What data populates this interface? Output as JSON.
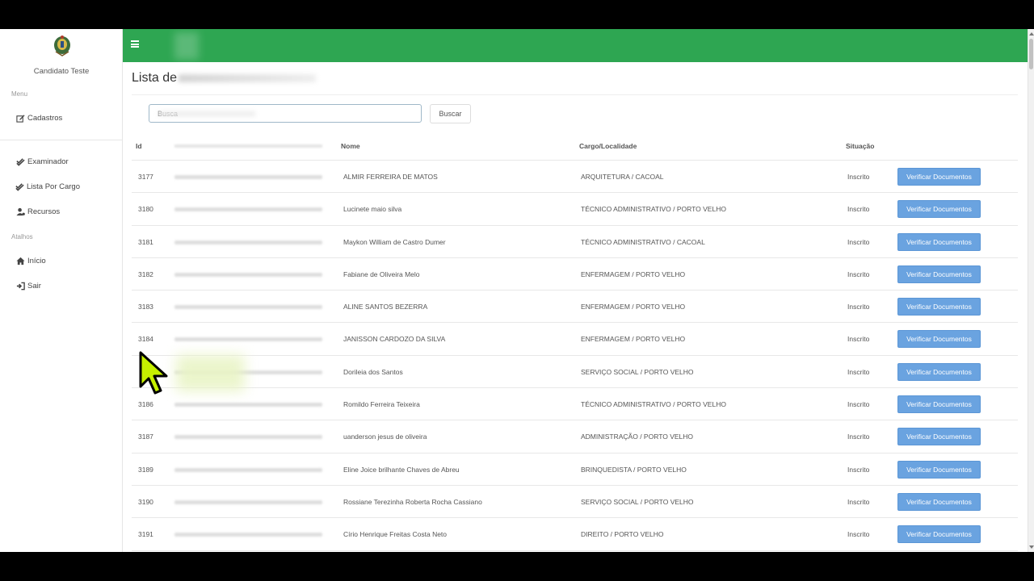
{
  "sidebar": {
    "user_name": "Candidato Teste",
    "menu_title": "Menu",
    "menu_items": [
      {
        "label": "Cadastros",
        "icon": "edit-icon"
      }
    ],
    "exam_items": [
      {
        "label": "Examinador",
        "icon": "check-double-icon"
      },
      {
        "label": "Lista Por Cargo",
        "icon": "check-double-icon"
      },
      {
        "label": "Recursos",
        "icon": "user-gear-icon"
      }
    ],
    "shortcuts_title": "Atalhos",
    "shortcut_items": [
      {
        "label": "Início",
        "icon": "home-icon"
      },
      {
        "label": "Sair",
        "icon": "sign-out-icon"
      }
    ]
  },
  "topbar": {
    "color": "#2ea652",
    "menu_icon": "hamburger-icon"
  },
  "main": {
    "title": "Lista de",
    "search": {
      "placeholder": "Busca",
      "button_label": "Buscar"
    },
    "table": {
      "headers": {
        "id": "Id",
        "name": "Nome",
        "cargo": "Cargo/Localidade",
        "situacao": "Situação"
      },
      "action_label": "Verificar Documentos",
      "rows": [
        {
          "id": "3177",
          "name": "ALMIR FERREIRA DE MATOS",
          "cargo": "ARQUITETURA / CACOAL",
          "situacao": "Inscrito"
        },
        {
          "id": "3180",
          "name": "Lucinete maio silva",
          "cargo": "TÉCNICO ADMINISTRATIVO / PORTO VELHO",
          "situacao": "Inscrito"
        },
        {
          "id": "3181",
          "name": "Maykon William de Castro Dumer",
          "cargo": "TÉCNICO ADMINISTRATIVO / CACOAL",
          "situacao": "Inscrito"
        },
        {
          "id": "3182",
          "name": "Fabiane de Oliveira Melo",
          "cargo": "ENFERMAGEM / PORTO VELHO",
          "situacao": "Inscrito"
        },
        {
          "id": "3183",
          "name": "ALINE SANTOS BEZERRA",
          "cargo": "ENFERMAGEM / PORTO VELHO",
          "situacao": "Inscrito"
        },
        {
          "id": "3184",
          "name": "JANISSON CARDOZO DA SILVA",
          "cargo": "ENFERMAGEM / PORTO VELHO",
          "situacao": "Inscrito"
        },
        {
          "id": "",
          "name": "Dorileia dos Santos",
          "cargo": "SERVIÇO SOCIAL / PORTO VELHO",
          "situacao": "Inscrito"
        },
        {
          "id": "3186",
          "name": "Romildo Ferreira Teixeira",
          "cargo": "TÉCNICO ADMINISTRATIVO / PORTO VELHO",
          "situacao": "Inscrito"
        },
        {
          "id": "3187",
          "name": "uanderson jesus de oliveira",
          "cargo": "ADMINISTRAÇÃO / PORTO VELHO",
          "situacao": "Inscrito"
        },
        {
          "id": "3189",
          "name": "Eline Joice brilhante Chaves de Abreu",
          "cargo": "BRINQUEDISTA / PORTO VELHO",
          "situacao": "Inscrito"
        },
        {
          "id": "3190",
          "name": "Rossiane Terezinha Roberta Rocha Cassiano",
          "cargo": "SERVIÇO SOCIAL / PORTO VELHO",
          "situacao": "Inscrito"
        },
        {
          "id": "3191",
          "name": "Círio Henrique Freitas Costa Neto",
          "cargo": "DIREITO / PORTO VELHO",
          "situacao": "Inscrito"
        }
      ]
    }
  },
  "colors": {
    "accent": "#2ea652",
    "button": "#6aa3e0",
    "cursor": "#c6f000"
  }
}
